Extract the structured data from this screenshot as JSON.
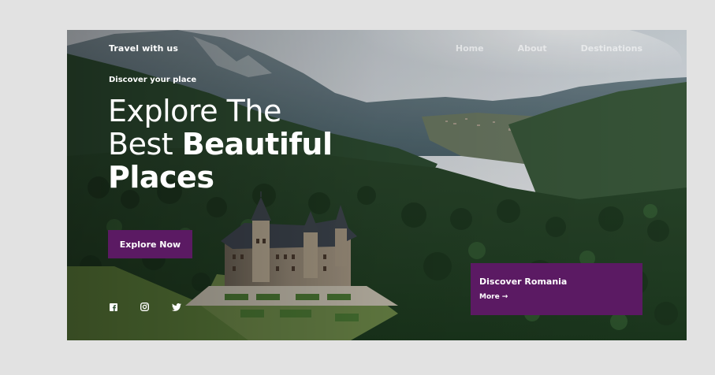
{
  "nav": {
    "brand": "Travel with us",
    "links": [
      "Home",
      "About",
      "Destinations"
    ]
  },
  "hero": {
    "eyebrow": "Discover your place",
    "headline": {
      "line1": "Explore The",
      "line2_light": "Best ",
      "line2_bold": "Beautiful",
      "line3": "Places"
    },
    "cta_label": "Explore Now",
    "background_icon": "castle-landscape-photo"
  },
  "socials": {
    "icons": [
      "facebook-icon",
      "instagram-icon",
      "twitter-icon"
    ]
  },
  "card": {
    "title": "Discover Romania",
    "more_label": "More",
    "arrow": "→"
  },
  "colors": {
    "page_bg": "#e2e2e2",
    "accent": "#5b1a63",
    "text": "#ffffff"
  }
}
